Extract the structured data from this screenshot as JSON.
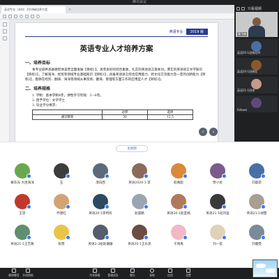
{
  "app": {
    "window_title": "腾讯会议"
  },
  "viewer": {
    "tab_title": "英语专业（本科）2019级培养方案",
    "page_header_label": "英语专业",
    "page_header_year": "2019 版",
    "doc_title": "英语专业人才培养方案",
    "section1_title": "一、培养目标",
    "section1_text": "本专业培养具备德智体美劳全面发展【目标1】，具有良好的综合素质，扎实的英语语言基本功，厚实的英语语言文学知识【目标1】，了解海洋、经贸等领域专业基础知识【目标1】，具备英语语言综合应用能力、跨文化交流能力及一定的创新能力【目标2】，能够在经贸、翻译、海洋等领域从事贸易、翻译、管理等方面工作的应用型人才【目标3】。",
    "section2_title": "二、培养规格",
    "spec1": "1. 学制：基本学制4年，弹性学习年限：3—6年。",
    "spec2": "2. 授予学位：文学学士",
    "spec3": "3. 毕业学分要求：",
    "table": {
      "headers": [
        "",
        "必修",
        "选修"
      ],
      "rows": [
        [
          "通识教育",
          "30",
          "12.5"
        ]
      ]
    }
  },
  "right_panel": {
    "toggle_label": "只看视频",
    "speaker_name": "喜飞林",
    "thumbnails": [
      {
        "name": "英语20-1班杨纪明"
      },
      {
        "name": "英语20-1班杨钰"
      },
      {
        "name": "英语21-1班李"
      },
      {
        "name": "followo"
      }
    ]
  },
  "gallery": {
    "toggle_label": "主视图"
  },
  "participants": [
    {
      "name": "秦东光·大连海洋"
    },
    {
      "name": "玉"
    },
    {
      "name": "须白西"
    },
    {
      "name": "英语2020-1 李"
    },
    {
      "name": "赵路超"
    },
    {
      "name": "赞小龙"
    },
    {
      "name": "刘晨昂"
    },
    {
      "name": "王思"
    },
    {
      "name": "乔建红"
    },
    {
      "name": "英语20-1李柯彤"
    },
    {
      "name": "赵晨鹏"
    },
    {
      "name": "英语20-1赵圣楠"
    },
    {
      "name": "英语21-1班刘鉴"
    },
    {
      "name": "英语21-1胡慧"
    },
    {
      "name": "英语21-1王艺路"
    },
    {
      "name": "张雯"
    },
    {
      "name": "英语2-3班赵珊珊"
    },
    {
      "name": "英语20-1王乐凯"
    },
    {
      "name": "于晓禹"
    },
    {
      "name": "刘一蓓"
    },
    {
      "name": "刘睿雯"
    }
  ],
  "controls": [
    {
      "label": "解除静音"
    },
    {
      "label": "开启视频"
    },
    {
      "label": "共享屏幕"
    },
    {
      "label": "管理成员"
    },
    {
      "label": "聊天"
    },
    {
      "label": "录制"
    },
    {
      "label": "应用"
    },
    {
      "label": "设置"
    }
  ]
}
